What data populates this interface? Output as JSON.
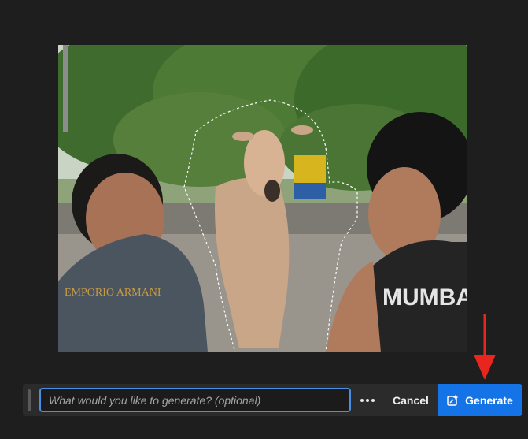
{
  "canvas": {
    "image_description_alt": "Photo of two young men with a cow between them",
    "shirt_text_left": "EMPORIO ARMANI",
    "shirt_text_right": "MUMBA"
  },
  "taskbar": {
    "prompt_placeholder": "What would you like to generate? (optional)",
    "prompt_value": "",
    "cancel_label": "Cancel",
    "generate_label": "Generate",
    "more_icon": "more-horizontal-icon",
    "generate_icon": "generative-fill-icon"
  },
  "annotation": {
    "arrow_color": "#e8261d"
  },
  "colors": {
    "accent": "#1473e6",
    "focus_ring": "#4a90e2",
    "panel": "#2b2b2b",
    "background": "#1e1e1e"
  }
}
